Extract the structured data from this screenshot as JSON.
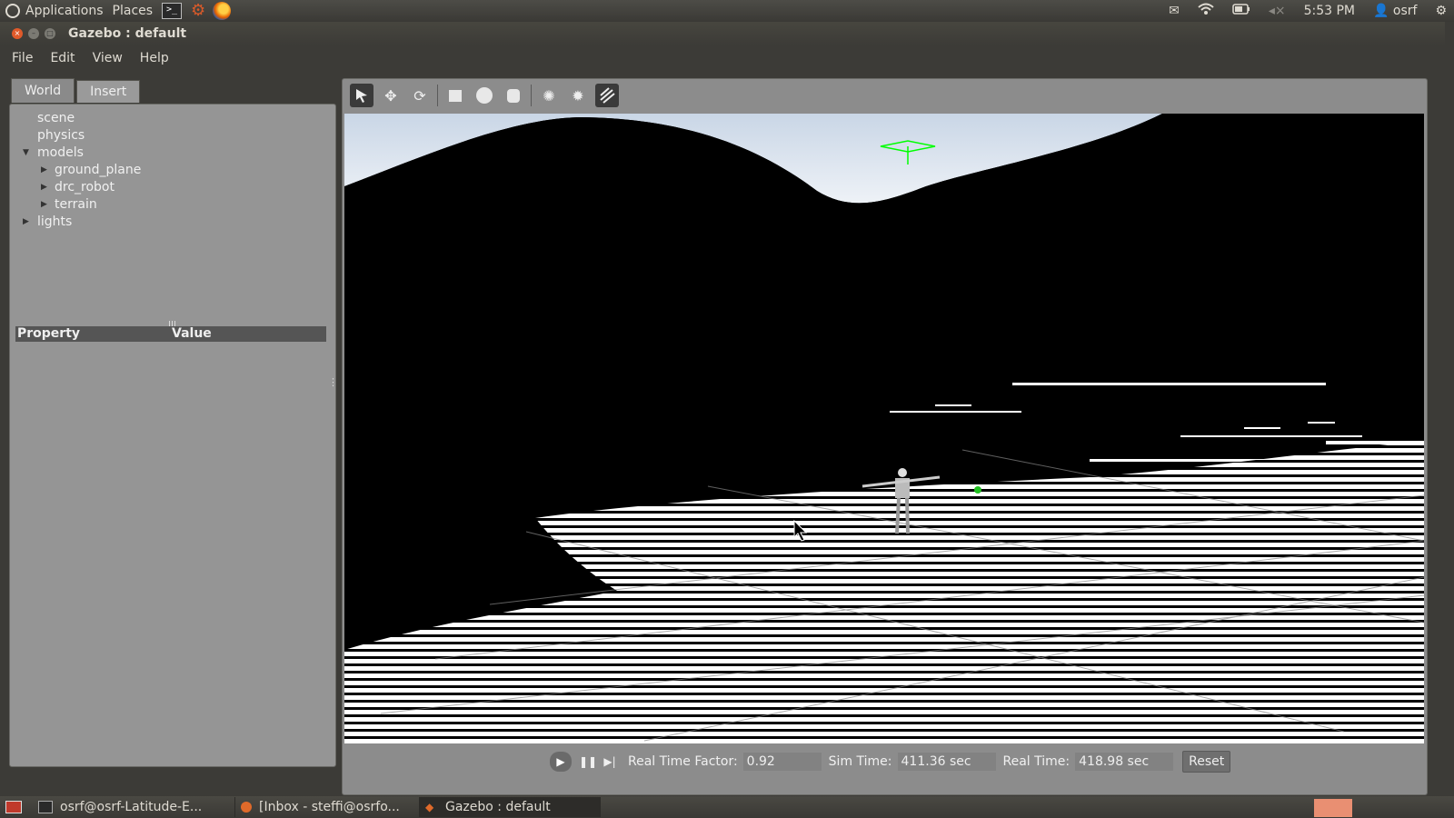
{
  "top_panel": {
    "menus": [
      "Applications",
      "Places"
    ],
    "time": "5:53 PM",
    "user": "osrf"
  },
  "window": {
    "title": "Gazebo : default",
    "menu": [
      "File",
      "Edit",
      "View",
      "Help"
    ]
  },
  "left_panel": {
    "tabs": [
      "World",
      "Insert"
    ],
    "tree": [
      {
        "label": "scene"
      },
      {
        "label": "physics"
      },
      {
        "label": "models"
      },
      {
        "label": "ground_plane"
      },
      {
        "label": "drc_robot"
      },
      {
        "label": "terrain"
      },
      {
        "label": "lights"
      }
    ],
    "property_header": "Property",
    "value_header": "Value"
  },
  "sim_bar": {
    "rtf_label": "Real Time Factor:",
    "rtf_value": "0.92",
    "sim_time_label": "Sim Time:",
    "sim_time_value": "411.36 sec",
    "real_time_label": "Real Time:",
    "real_time_value": "418.98 sec",
    "reset_label": "Reset"
  },
  "taskbar": {
    "items": [
      "osrf@osrf-Latitude-E...",
      "[Inbox - steffi@osrfo...",
      "Gazebo : default"
    ]
  },
  "colors": {
    "panel_bg": "#3c3b37",
    "sidebar_bg": "#959595",
    "close_button": "#e05a2a",
    "sky": "#d9e3ee",
    "selection_box": "#00ff00"
  },
  "icons": [
    "ubuntu-logo",
    "terminal-icon",
    "tools-icon",
    "firefox-icon",
    "mail-icon",
    "wifi-icon",
    "battery-icon",
    "volume-icon",
    "user-icon",
    "power-icon",
    "select-icon",
    "translate-icon",
    "rotate-icon",
    "box-icon",
    "sphere-icon",
    "cylinder-icon",
    "point-light-icon",
    "spot-light-icon",
    "directional-light-icon",
    "play-icon",
    "pause-icon",
    "step-icon"
  ]
}
